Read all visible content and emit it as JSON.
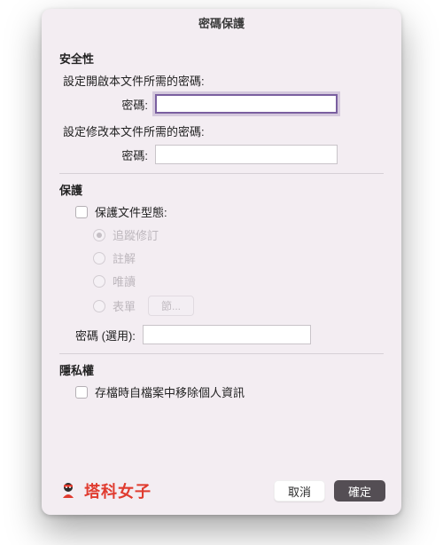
{
  "dialog": {
    "title": "密碼保護"
  },
  "security": {
    "heading": "安全性",
    "open_desc": "設定開啟本文件所需的密碼:",
    "open_label": "密碼:",
    "open_value": "",
    "modify_desc": "設定修改本文件所需的密碼:",
    "modify_label": "密碼:",
    "modify_value": ""
  },
  "protect": {
    "heading": "保護",
    "protect_doc_label": "保護文件型態:",
    "radios": {
      "track": "追蹤修訂",
      "comment": "註解",
      "readonly": "唯讀",
      "form": "表單"
    },
    "section_btn": "節...",
    "optional_pw_label": "密碼 (選用):",
    "optional_pw_value": ""
  },
  "privacy": {
    "heading": "隱私權",
    "remove_personal_label": "存檔時自檔案中移除個人資訊"
  },
  "brand": {
    "text": "塔科女子"
  },
  "buttons": {
    "cancel": "取消",
    "ok": "確定"
  }
}
